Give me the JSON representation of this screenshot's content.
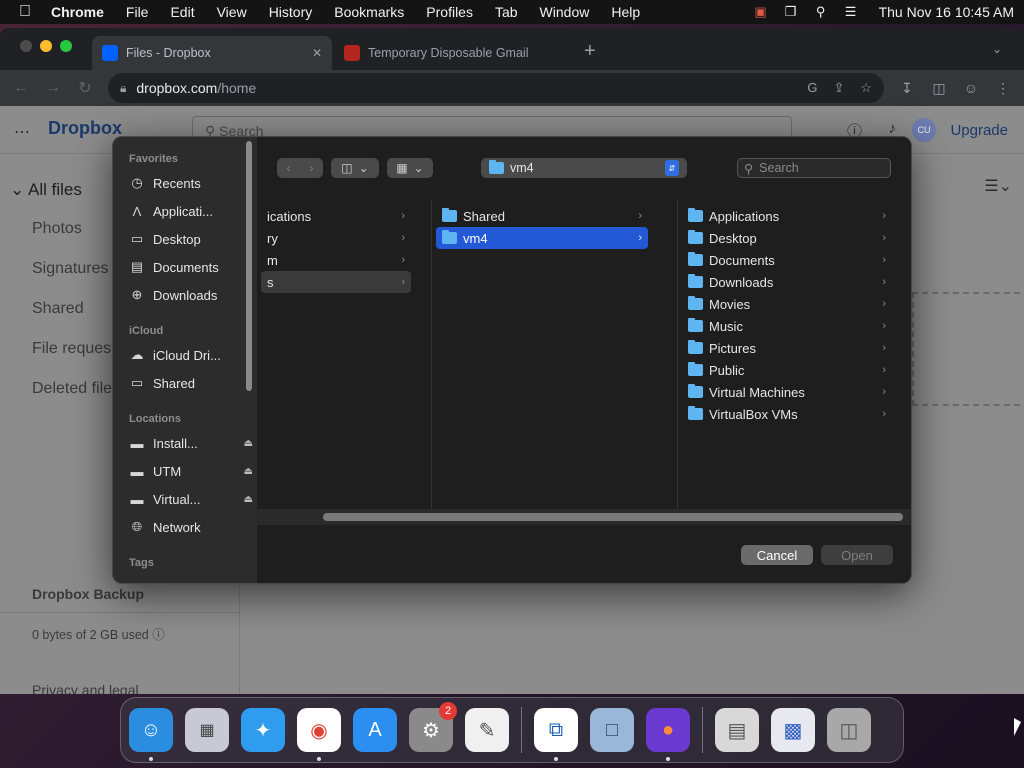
{
  "menubar": {
    "app_name": "Chrome",
    "items": [
      "File",
      "Edit",
      "View",
      "History",
      "Bookmarks",
      "Profiles",
      "Tab",
      "Window",
      "Help"
    ],
    "clock": "Thu Nov 16  10:45 AM"
  },
  "browser": {
    "tabs": [
      {
        "title": "Files - Dropbox",
        "favicon_color": "#0061fe"
      },
      {
        "title": "Temporary Disposable Gmail",
        "favicon_color": "#b3261e"
      }
    ],
    "url_host": "dropbox.com",
    "url_path": "/home"
  },
  "dropbox": {
    "logo": "Dropbox",
    "search_placeholder": "Search",
    "upgrade": "Upgrade",
    "avatar": "CU",
    "sidebar": [
      "All files",
      "Photos",
      "Signatures",
      "Shared",
      "File requests",
      "Deleted files"
    ],
    "backup_title": "Dropbox Backup",
    "usage": "0 bytes of 2 GB used",
    "privacy": "Privacy and legal"
  },
  "dialog": {
    "favorites_label": "Favorites",
    "favorites": [
      {
        "label": "Recents",
        "icon": "clock-icon"
      },
      {
        "label": "Applicati...",
        "icon": "apps-icon"
      },
      {
        "label": "Desktop",
        "icon": "desktop-icon"
      },
      {
        "label": "Documents",
        "icon": "document-icon"
      },
      {
        "label": "Downloads",
        "icon": "download-icon"
      }
    ],
    "icloud_label": "iCloud",
    "icloud": [
      {
        "label": "iCloud Dri...",
        "icon": "cloud-icon"
      },
      {
        "label": "Shared",
        "icon": "shared-folder-icon"
      }
    ],
    "locations_label": "Locations",
    "locations": [
      {
        "label": "Install...",
        "icon": "drive-icon",
        "eject": true
      },
      {
        "label": "UTM",
        "icon": "drive-icon",
        "eject": true
      },
      {
        "label": "Virtual...",
        "icon": "drive-icon",
        "eject": true
      },
      {
        "label": "Network",
        "icon": "network-icon",
        "eject": false
      }
    ],
    "tags_label": "Tags",
    "path_label": "vm4",
    "search_placeholder": "Search",
    "column1": [
      "ications",
      "ry",
      "m",
      "s"
    ],
    "column2": [
      {
        "label": "Shared",
        "selected": false
      },
      {
        "label": "vm4",
        "selected": true
      }
    ],
    "column3": [
      "Applications",
      "Desktop",
      "Documents",
      "Downloads",
      "Movies",
      "Music",
      "Pictures",
      "Public",
      "Virtual Machines",
      "VirtualBox VMs"
    ],
    "cancel_label": "Cancel",
    "open_label": "Open"
  },
  "dock": {
    "settings_badge": "2",
    "apps": [
      {
        "name": "finder-icon",
        "color": "#2a8de0"
      },
      {
        "name": "launchpad-icon",
        "color": "#c9c9d6"
      },
      {
        "name": "safari-icon",
        "color": "#2f9cf0"
      },
      {
        "name": "chrome-icon",
        "color": "#ffffff"
      },
      {
        "name": "app-store-icon",
        "color": "#2a8ff0"
      },
      {
        "name": "system-settings-icon",
        "color": "#8a8a8a"
      },
      {
        "name": "textedit-icon",
        "color": "#f0f0f0"
      },
      {
        "name": "screen-sharing-icon",
        "color": "#ffffff"
      },
      {
        "name": "virtualbox-icon",
        "color": "#9ab6d8"
      },
      {
        "name": "firefox-icon",
        "color": "#6a3ad0"
      },
      {
        "name": "disk-image-icon",
        "color": "#d8d8d8"
      },
      {
        "name": "preview-window-icon",
        "color": "#e8e8f0"
      },
      {
        "name": "trash-icon",
        "color": "#a8a8a8"
      }
    ]
  }
}
